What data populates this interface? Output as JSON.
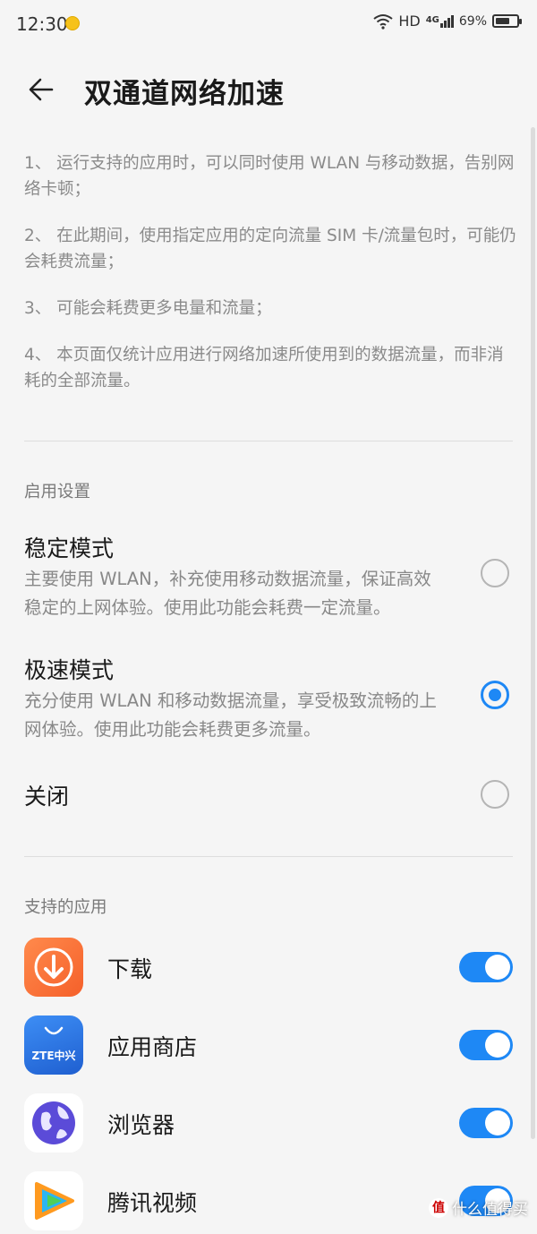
{
  "status_bar": {
    "time": "12:30",
    "network": "HD",
    "signal": "4G",
    "battery": "69%",
    "battery_level": 0.69
  },
  "header": {
    "title": "双通道网络加速",
    "back_icon": "arrow-left-icon"
  },
  "notes": [
    "1、 运行支持的应用时，可以同时使用 WLAN 与移动数据，告别网络卡顿；",
    "2、 在此期间，使用指定应用的定向流量 SIM 卡/流量包时，可能仍会耗费流量；",
    "3、 可能会耗费更多电量和流量；",
    "4、 本页面仅统计应用进行网络加速所使用到的数据流量，而非消耗的全部流量。"
  ],
  "settings": {
    "section_label": "启用设置",
    "modes": [
      {
        "title": "稳定模式",
        "desc": "主要使用 WLAN，补充使用移动数据流量，保证高效稳定的上网体验。使用此功能会耗费一定流量。",
        "selected": false
      },
      {
        "title": "极速模式",
        "desc": "充分使用 WLAN 和移动数据流量，享受极致流畅的上网体验。使用此功能会耗费更多流量。",
        "selected": true
      },
      {
        "title": "关闭",
        "desc": "",
        "selected": false
      }
    ]
  },
  "apps": {
    "section_label": "支持的应用",
    "items": [
      {
        "name": "下载",
        "icon": "download-app-icon",
        "enabled": true
      },
      {
        "name": "应用商店",
        "icon": "zte-app-store-icon",
        "icon_text": "ZTE中兴",
        "enabled": true
      },
      {
        "name": "浏览器",
        "icon": "browser-globe-icon",
        "enabled": true
      },
      {
        "name": "腾讯视频",
        "icon": "tencent-video-icon",
        "enabled": true
      }
    ]
  },
  "watermark": {
    "badge": "值",
    "text": "什么值得买"
  },
  "colors": {
    "accent": "#1e88f5",
    "background": "#f5f5f5",
    "muted_text": "#888888"
  }
}
